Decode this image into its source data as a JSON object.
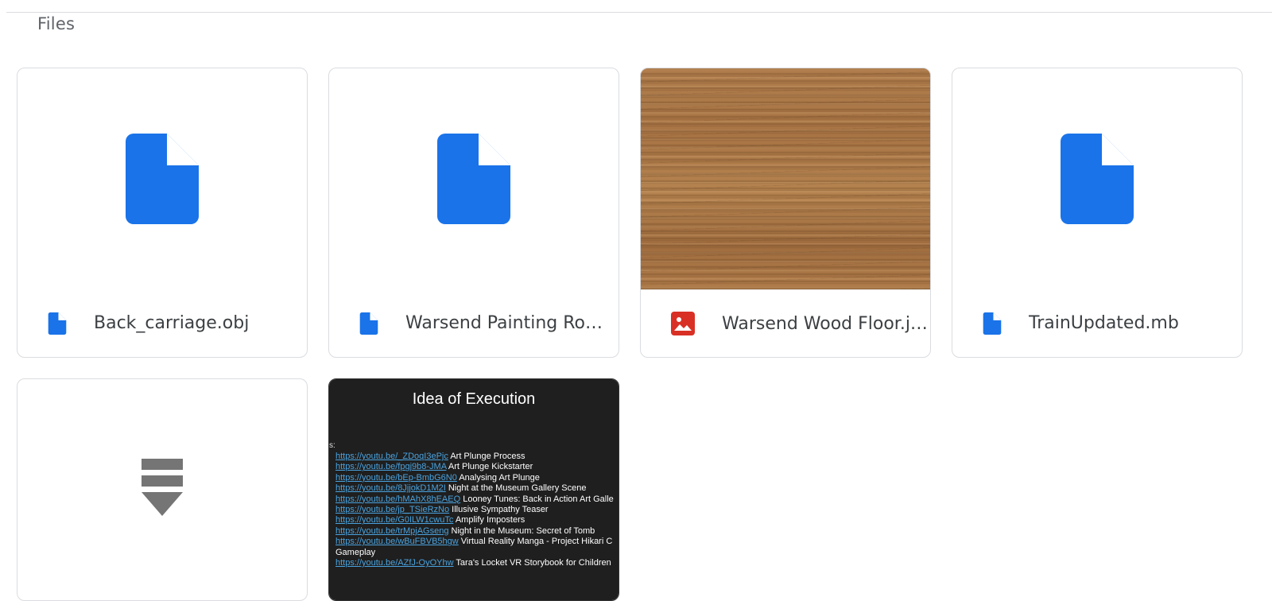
{
  "section": {
    "title": "Files"
  },
  "colors": {
    "doc_blue": "#1a73e8",
    "image_red": "#d93025",
    "slide_bg": "#1f1f1f",
    "link": "#4aa3df"
  },
  "files": [
    {
      "name": "Back_carriage.obj",
      "type_icon": "doc-icon",
      "preview": "doc-icon"
    },
    {
      "name": "Warsend Painting Roo…",
      "type_icon": "doc-icon",
      "preview": "doc-icon"
    },
    {
      "name": "Warsend Wood Floor.j…",
      "type_icon": "image-icon",
      "preview": "wood-texture"
    },
    {
      "name": "TrainUpdated.mb",
      "type_icon": "doc-icon",
      "preview": "doc-icon"
    },
    {
      "name": "",
      "preview": "download-icon"
    },
    {
      "name": "",
      "preview": "slide"
    }
  ],
  "slide": {
    "title": "Idea of Execution",
    "prefix": "s:",
    "lines": [
      {
        "link": "https://youtu.be/_ZDoqI3ePjc",
        "text": " Art Plunge Process"
      },
      {
        "link": "https://youtu.be/fpgj9b8-JMA",
        "text": " Art Plunge Kickstarter"
      },
      {
        "link": "https://youtu.be/bEp-BmbG6N0",
        "text": " Analysing Art Plunge"
      },
      {
        "link": "https://youtu.be/8JjjokD1M2I",
        "text": " Night at the Museum Gallery Scene"
      },
      {
        "link": "https://youtu.be/hMAhX8hEAEQ",
        "text": " Looney Tunes: Back in Action Art Galle"
      },
      {
        "link": "https://youtu.be/jp_TSieRzNo",
        "text": " Illusive Sympathy Teaser"
      },
      {
        "link": "https://youtu.be/G0ILW1cwuTc",
        "text": " Amplify Imposters"
      },
      {
        "link": "https://youtu.be/trMpjAGseng",
        "text": " Night in the Museum: Secret of Tomb"
      },
      {
        "link": "https://youtu.be/wBuFBVB5hgw",
        "text": " Virtual Reality Manga - Project Hikari C"
      },
      {
        "link": "",
        "text": "Gameplay"
      },
      {
        "link": "https://youtu.be/AZfJ-OyOYhw",
        "text": " Tara's Locket VR Storybook for Children"
      }
    ]
  }
}
